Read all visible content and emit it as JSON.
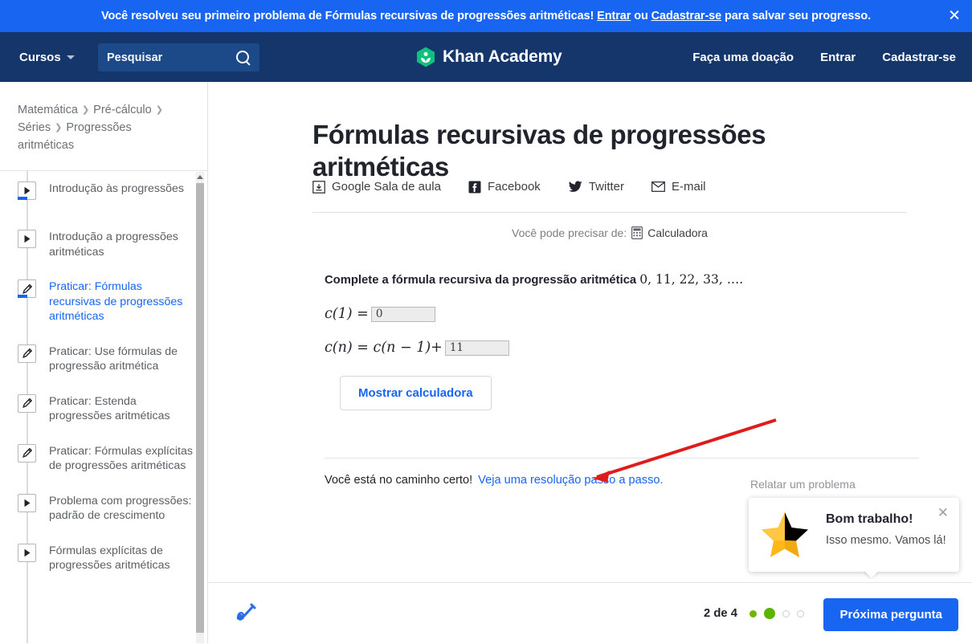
{
  "banner": {
    "text_before": "Você resolveu seu primeiro problema de Fórmulas recursivas de progressões aritméticas! ",
    "link_signin": "Entrar",
    "text_middle": " ou ",
    "link_signup": "Cadastrar-se",
    "text_after": " para salvar seu progresso.",
    "close_label": "✕",
    "background": "#1865f2"
  },
  "header": {
    "courses_label": "Cursos",
    "search_placeholder": "Pesquisar",
    "search_value": "",
    "brand_name": "Khan Academy",
    "links": [
      {
        "label": "Faça uma doação"
      },
      {
        "label": "Entrar"
      },
      {
        "label": "Cadastrar-se"
      }
    ],
    "background": "#14366b",
    "logo_color": "#0ec27d"
  },
  "sidebar": {
    "breadcrumb": [
      "Matemática",
      "Pré-cálculo",
      "Séries",
      "Progressões aritméticas"
    ],
    "items": [
      {
        "label": "Introdução às progressões",
        "icon": "video-icon",
        "active": false,
        "progress": true
      },
      {
        "label": "Introdução a progressões aritméticas",
        "icon": "video-icon",
        "active": false,
        "progress": false
      },
      {
        "label": "Praticar: Fórmulas recursivas de progressões aritméticas",
        "icon": "exercise-icon",
        "active": true,
        "progress": true
      },
      {
        "label": "Praticar: Use fórmulas de progressão aritmética",
        "icon": "exercise-icon",
        "active": false,
        "progress": false
      },
      {
        "label": "Praticar: Estenda progressões aritméticas",
        "icon": "exercise-icon",
        "active": false,
        "progress": false
      },
      {
        "label": "Praticar: Fórmulas explícitas de progressões aritméticas",
        "icon": "exercise-icon",
        "active": false,
        "progress": false
      },
      {
        "label": "Problema com progressões: padrão de crescimento",
        "icon": "video-icon",
        "active": false,
        "progress": false
      },
      {
        "label": "Fórmulas explícitas de progressões aritméticas",
        "icon": "video-icon",
        "active": false,
        "progress": false
      }
    ]
  },
  "main": {
    "title": "Fórmulas recursivas de progressões aritméticas",
    "share": [
      {
        "label": "Google Sala de aula",
        "icon": "google-classroom-icon"
      },
      {
        "label": "Facebook",
        "icon": "facebook-icon"
      },
      {
        "label": "Twitter",
        "icon": "twitter-icon"
      },
      {
        "label": "E-mail",
        "icon": "email-icon"
      }
    ],
    "calculator_hint": "Você pode precisar de:",
    "calculator_label": "Calculadora",
    "question_prefix": "Complete a fórmula recursiva da progressão aritmética",
    "question_sequence": "0, 11, 22, 33, ….",
    "formula1": {
      "lhs": "c(1) =",
      "value": "0"
    },
    "formula2": {
      "lhs_a": "c(n) = c(n − 1)+",
      "value": "11"
    },
    "show_calculator_button": "Mostrar calculadora",
    "feedback_text": "Você está no caminho certo!",
    "feedback_link": "Veja uma resolução passo a passo.",
    "report_problem": "Relatar um problema",
    "accent_color": "#1865f2"
  },
  "toast": {
    "title": "Bom trabalho!",
    "subtitle": "Isso mesmo. Vamos lá!",
    "close_label": "✕",
    "icon": "star-icon",
    "star_color": "#ffb819"
  },
  "bottom": {
    "scratchpad_icon": "scratchpad-icon",
    "progress_count": "2 de 4",
    "dots": [
      "done",
      "current",
      "todo",
      "todo"
    ],
    "next_button": "Próxima pergunta",
    "dot_done_color": "#71b307",
    "dot_current_color": "#5cb400"
  }
}
